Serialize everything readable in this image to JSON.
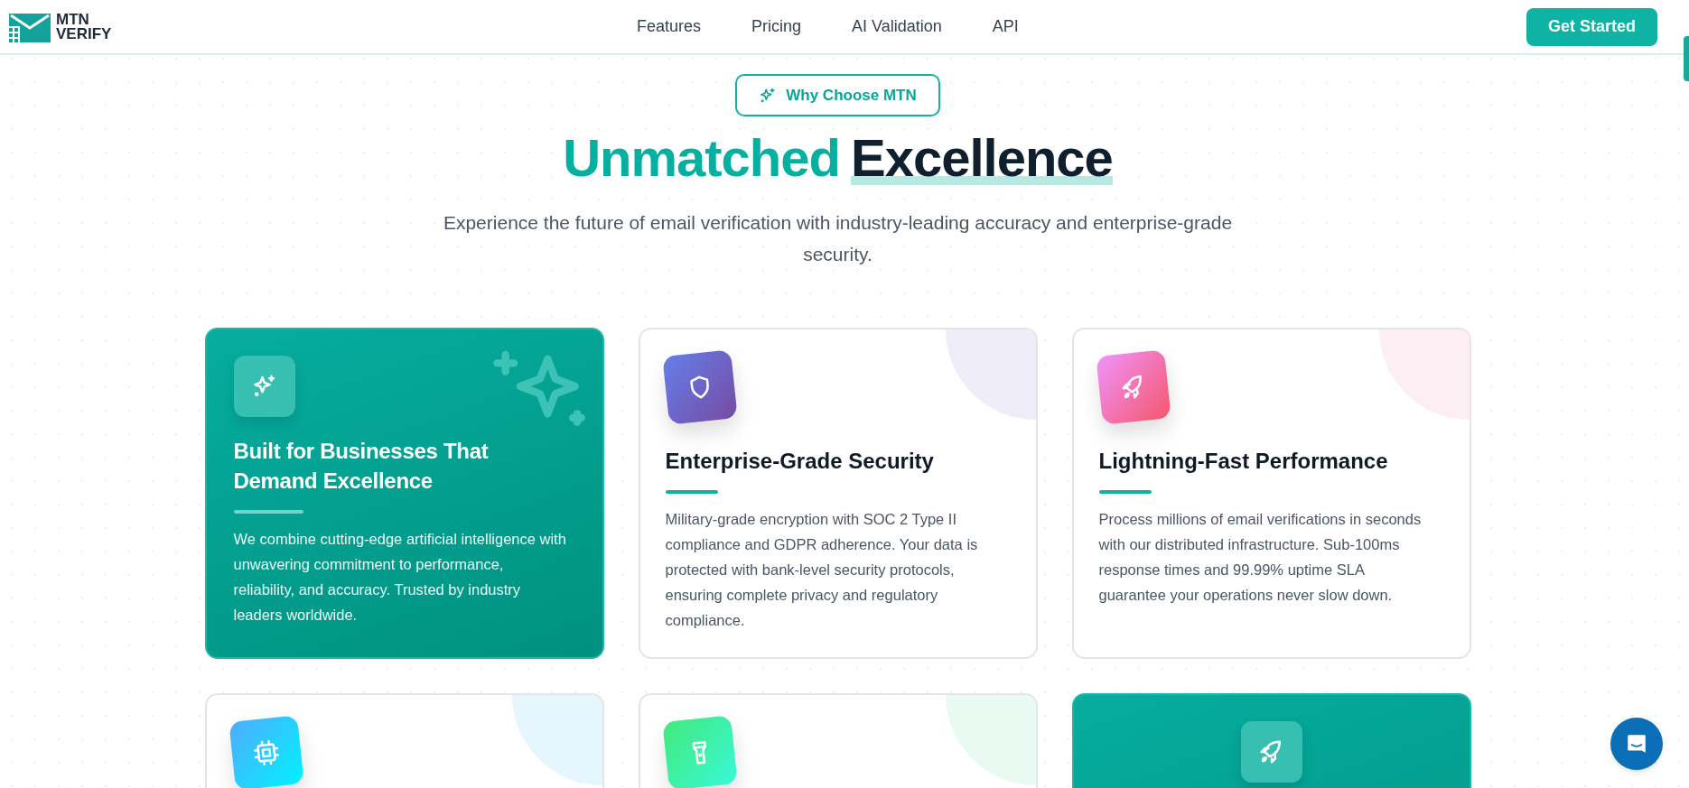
{
  "header": {
    "logo": {
      "line_1": "MTN",
      "line_2": "VERIFY"
    },
    "nav": [
      {
        "label": "Features"
      },
      {
        "label": "Pricing"
      },
      {
        "label": "AI Validation"
      },
      {
        "label": "API"
      }
    ],
    "cta": "Get Started"
  },
  "badge": "Why Choose MTN",
  "heading": {
    "accent": "Unmatched",
    "main": "Excellence"
  },
  "subtitle": "Experience the future of email verification with industry-leading accuracy and enterprise-grade security.",
  "cards": [
    {
      "kind": "featured",
      "title": "Built for Businesses That Demand Excellence",
      "text": "We combine cutting-edge artificial intelligence with unwavering commitment to performance, reliability, and accuracy. Trusted by industry leaders worldwide."
    },
    {
      "kind": "plain",
      "title": "Enterprise-Grade Security",
      "text": "Military-grade encryption with SOC 2 Type II compliance and GDPR adherence. Your data is protected with bank-level security protocols, ensuring complete privacy and regulatory compliance."
    },
    {
      "kind": "plain",
      "title": "Lightning-Fast Performance",
      "text": "Process millions of email verifications in seconds with our distributed infrastructure. Sub-100ms response times and 99.99% uptime SLA guarantee your operations never slow down."
    },
    {
      "kind": "plain"
    },
    {
      "kind": "plain"
    },
    {
      "kind": "featured"
    }
  ]
}
